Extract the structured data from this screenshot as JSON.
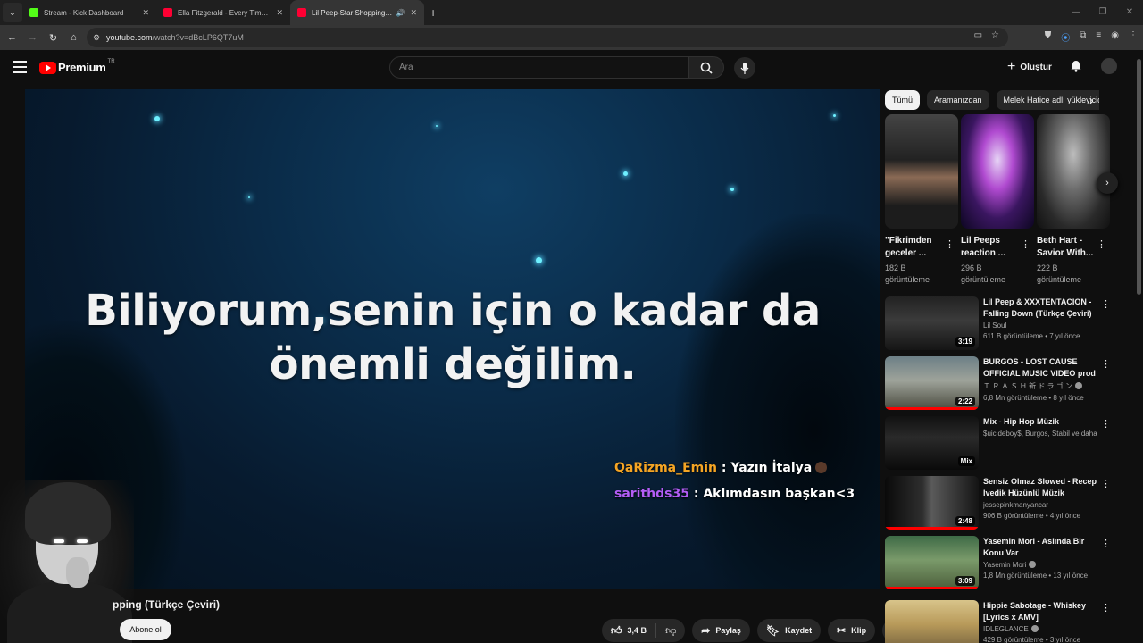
{
  "browser": {
    "tabs": [
      {
        "title": "Stream - Kick Dashboard",
        "favicon_color": "#53fc18",
        "active": false
      },
      {
        "title": "Ella Fitzgerald - Every Time We",
        "favicon_color": "#ff0033",
        "active": false
      },
      {
        "title": "Lil Peep-Star Shopping (Tür",
        "favicon_color": "#ff0033",
        "active": true
      }
    ],
    "url_host": "youtube.com",
    "url_path": "/watch?v=dBcLP6QT7uM"
  },
  "header": {
    "logo_text": "Premium",
    "logo_region": "TR",
    "search_placeholder": "Ara",
    "create_label": "Oluştur"
  },
  "video": {
    "lyric_line1": "Biliyorum,senin için o kadar da",
    "lyric_line2": "önemli değilim.",
    "chat": [
      {
        "user": "QaRizma_Emin",
        "message": ": Yazın İtalya"
      },
      {
        "user": "sarithds35",
        "message": ": Aklımdasın başkan<3"
      }
    ],
    "title_partial": "pping (Türkçe Çeviri)",
    "subscribe_label": "Abone ol",
    "likes": "3,4 B",
    "share_label": "Paylaş",
    "save_label": "Kaydet",
    "clip_label": "Klip"
  },
  "sidebar": {
    "chips": [
      "Tümü",
      "Aramanızdan",
      "Melek Hatice adlı yükleyiciden"
    ],
    "shorts": [
      {
        "title": "\"Fikrimden geceler ...",
        "views": "182 B",
        "views_label": "görüntüleme"
      },
      {
        "title": "Lil Peeps reaction ...",
        "views": "296 B",
        "views_label": "görüntüleme"
      },
      {
        "title": "Beth Hart - Savior With...",
        "views": "222 B",
        "views_label": "görüntüleme"
      }
    ],
    "recommendations": [
      {
        "title": "Lil Peep & XXXTENTACION - Falling Down (Türkçe Çeviri)",
        "channel": "Lil Soul",
        "meta": "611 B görüntüleme • 7 yıl önce",
        "duration": "3:19"
      },
      {
        "title": "BURGOS - LOST CAUSE OFFICIAL MUSIC VIDEO prod b...",
        "channel": "Ｔ Ｒ Ａ Ｓ Ｈ 新 ド ラ ゴ ン",
        "meta": "6,8 Mn görüntüleme • 8 yıl önce",
        "duration": "2:22"
      },
      {
        "title": "Mix - Hip Hop Müzik",
        "channel": "$uicideboy$, Burgos, Stabil ve daha fazlası",
        "meta": "",
        "duration": "Mix"
      },
      {
        "title": "Sensiz Olmaz Slowed - Recep İvedik Hüzünlü Müzik",
        "channel": "jessepinkmanyancar",
        "meta": "906 B görüntüleme • 4 yıl önce",
        "duration": "2:48"
      },
      {
        "title": "Yasemin Mori - Aslında Bir Konu Var",
        "channel": "Yasemin Mori",
        "meta": "1,8 Mn görüntüleme • 13 yıl önce",
        "duration": "3:09"
      },
      {
        "title": "Hippie Sabotage - Whiskey [Lyrics x AMV]",
        "channel": "IDLEGLANCE",
        "meta": "429 B görüntüleme • 3 yıl önce",
        "duration": ""
      }
    ]
  }
}
